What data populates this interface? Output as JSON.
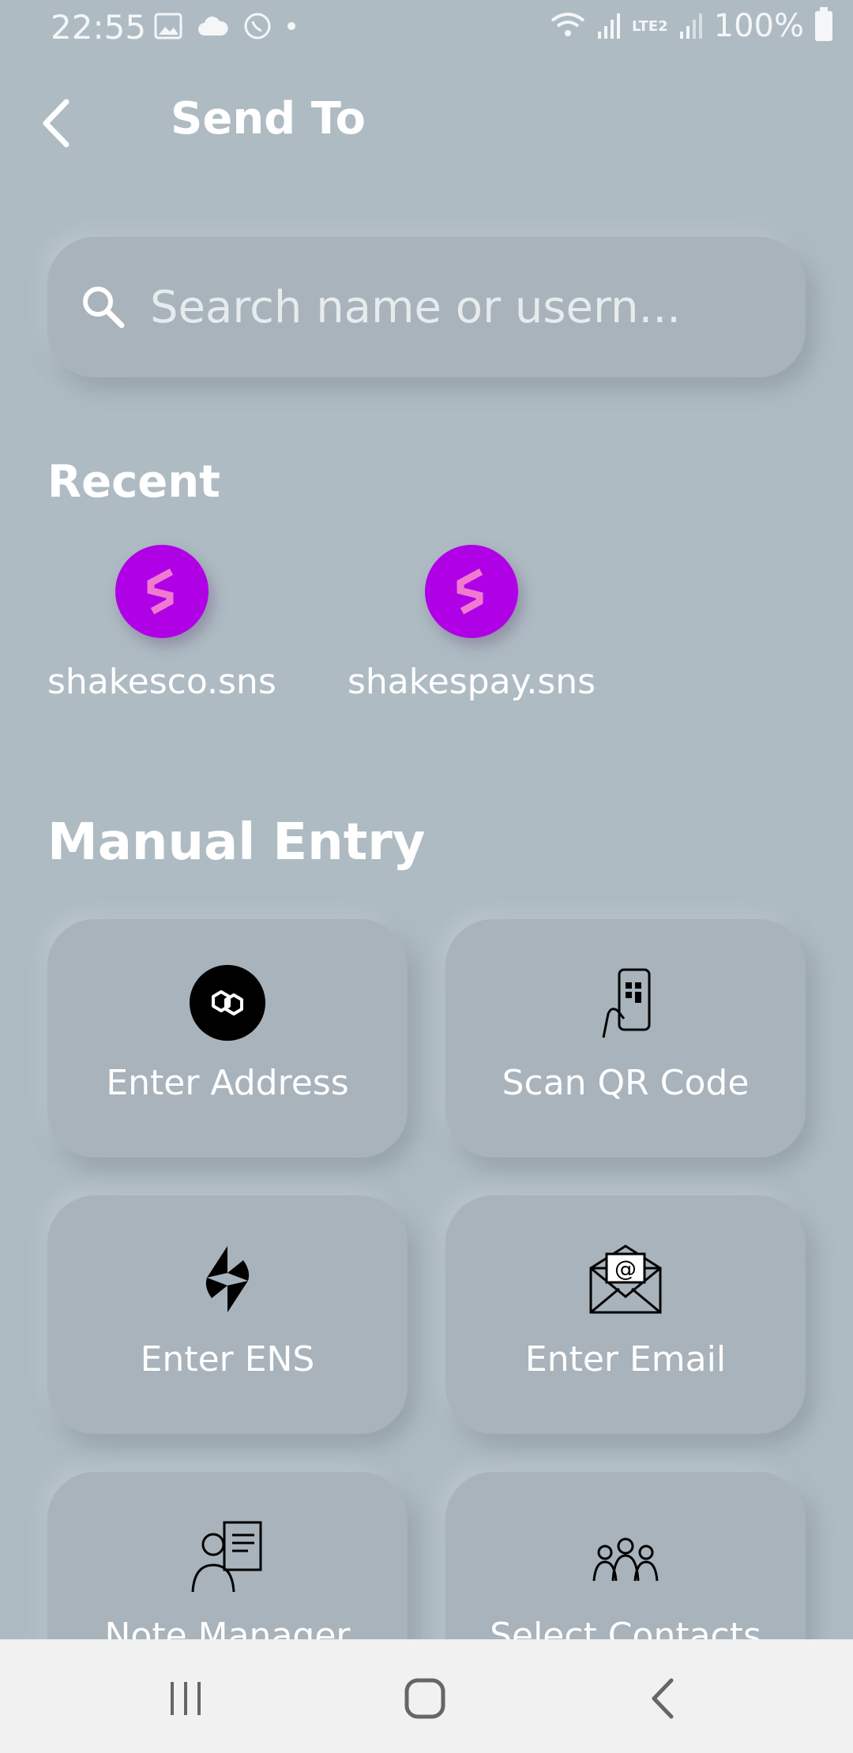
{
  "status_bar": {
    "time": "22:55",
    "battery": "100%",
    "network": "LTE2"
  },
  "header": {
    "title": "Send To"
  },
  "search": {
    "placeholder": "Search name or usern..."
  },
  "recent": {
    "title": "Recent",
    "items": [
      {
        "label": "shakesco.sns"
      },
      {
        "label": "shakespay.sns"
      }
    ]
  },
  "manual_entry": {
    "title": "Manual Entry",
    "cards": [
      {
        "label": "Enter Address",
        "icon": "polygon-icon"
      },
      {
        "label": "Scan QR Code",
        "icon": "qr-phone-icon"
      },
      {
        "label": "Enter ENS",
        "icon": "ens-icon"
      },
      {
        "label": "Enter Email",
        "icon": "email-icon"
      },
      {
        "label": "Note Manager",
        "icon": "manager-icon"
      },
      {
        "label": "Select Contacts",
        "icon": "contacts-icon"
      }
    ]
  },
  "colors": {
    "background": "#aebbc3",
    "card": "#a8b3bb",
    "avatar": "#b000e6",
    "navbar": "#f1f1f2"
  }
}
